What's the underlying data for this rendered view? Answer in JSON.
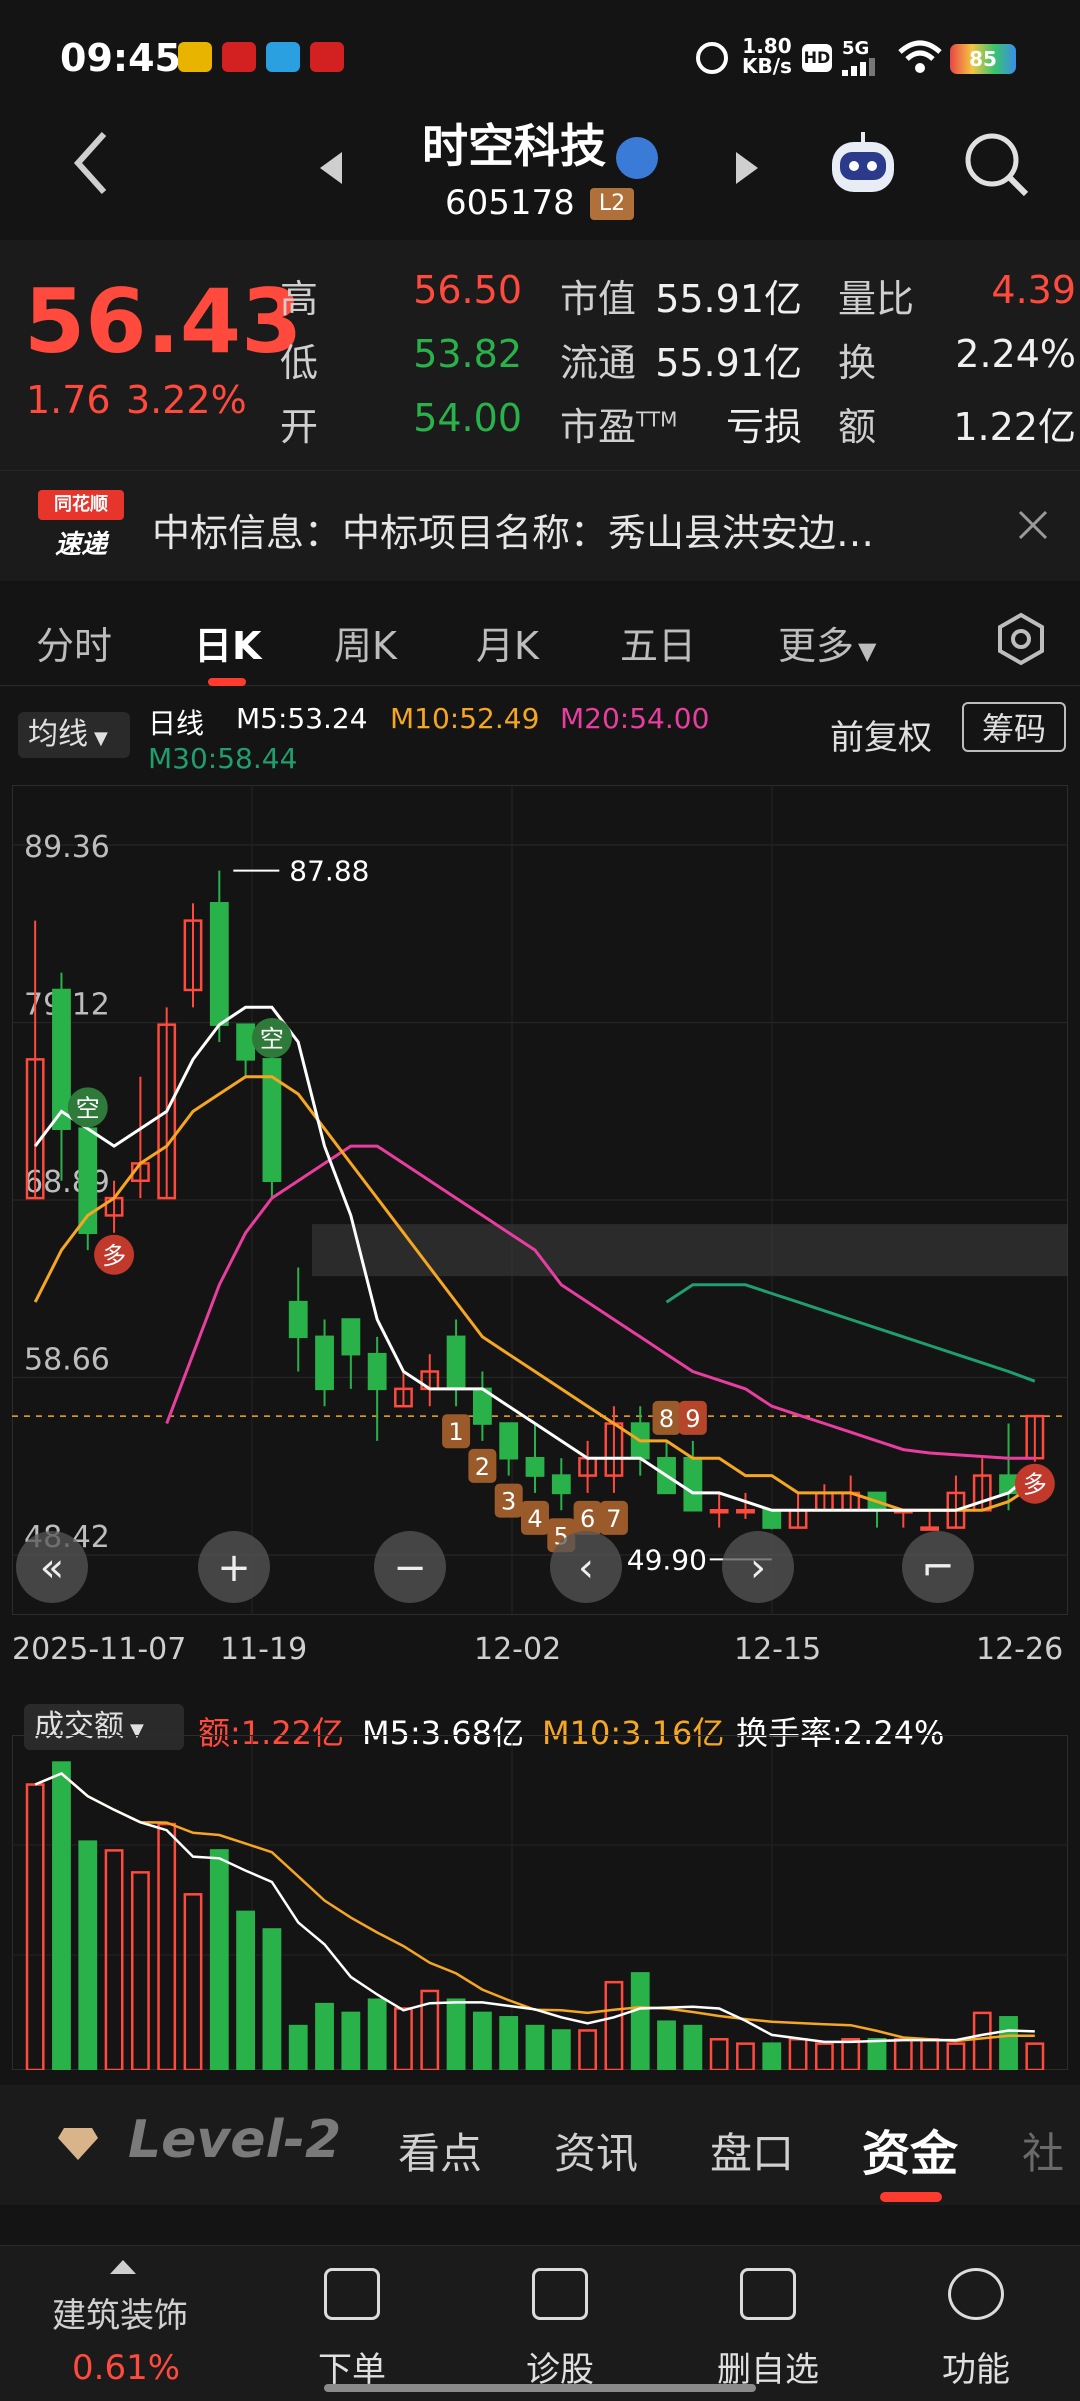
{
  "status_bar": {
    "time": "09:45",
    "net_speed": "1.80\nKB/s",
    "net_speed_top": "1.80",
    "net_speed_bottom": "KB/s",
    "signal": "5G",
    "battery": "85"
  },
  "header": {
    "name": "时空科技",
    "code": "605178",
    "level_badge": "L2"
  },
  "quote": {
    "price": "56.43",
    "change": "1.76",
    "change_pct": "3.22%",
    "high_label": "高",
    "high": "56.50",
    "low_label": "低",
    "low": "53.82",
    "open_label": "开",
    "open": "54.00",
    "mcap_label": "市值",
    "mcap": "55.91亿",
    "float_label": "流通",
    "float": "55.91亿",
    "pe_label": "市盈",
    "pe_sup": "TTM",
    "pe": "亏损",
    "volratio_label": "量比",
    "volratio": "4.39",
    "turnover_label": "换",
    "turnover": "2.24%",
    "amount_label": "额",
    "amount": "1.22亿"
  },
  "news": {
    "logo_top": "同花顺",
    "logo_bottom": "速递",
    "text": "中标信息：中标项目名称：秀山县洪安边…"
  },
  "tabs": [
    "分时",
    "日K",
    "周K",
    "月K",
    "五日",
    "更多"
  ],
  "active_tab": 1,
  "kline_header": {
    "indicator": "均线",
    "period": "日线",
    "m5": "M5:53.24",
    "m10": "M10:52.49",
    "m20": "M20:54.00",
    "m30": "M30:58.44",
    "adjust": "前复权",
    "chips": "筹码"
  },
  "colors": {
    "up": "#ff4a3d",
    "down": "#2ab24a",
    "m5": "#ffffff",
    "m10": "#f5a623",
    "m20": "#e83e9f",
    "m30": "#1f9e6e",
    "accent": "#ff3b30"
  },
  "chart_data": {
    "type": "candlestick",
    "y_ticks": [
      "89.36",
      "79.12",
      "68.89",
      "58.66",
      "48.42"
    ],
    "x_ticks": [
      "2025-11-07",
      "11-19",
      "12-02",
      "12-15",
      "12-26"
    ],
    "high_marker": "87.88",
    "low_marker": "49.90",
    "candles": [
      {
        "o": 69,
        "c": 77,
        "h": 85,
        "l": 69
      },
      {
        "o": 81,
        "c": 73,
        "h": 82,
        "l": 70
      },
      {
        "o": 73,
        "c": 67,
        "h": 74,
        "l": 66
      },
      {
        "o": 68,
        "c": 69,
        "h": 70,
        "l": 67
      },
      {
        "o": 70,
        "c": 71,
        "h": 76,
        "l": 69
      },
      {
        "o": 69,
        "c": 79,
        "h": 80,
        "l": 69
      },
      {
        "o": 81,
        "c": 85,
        "h": 86,
        "l": 80
      },
      {
        "o": 86,
        "c": 79,
        "h": 87.88,
        "l": 78
      },
      {
        "o": 79,
        "c": 77,
        "h": 79,
        "l": 76
      },
      {
        "o": 77,
        "c": 70,
        "h": 78,
        "l": 69
      },
      {
        "o": 63,
        "c": 61,
        "h": 65,
        "l": 59
      },
      {
        "o": 61,
        "c": 58,
        "h": 62,
        "l": 57
      },
      {
        "o": 62,
        "c": 60,
        "h": 62,
        "l": 58
      },
      {
        "o": 60,
        "c": 58,
        "h": 61,
        "l": 55
      },
      {
        "o": 57,
        "c": 58,
        "h": 59,
        "l": 57
      },
      {
        "o": 58,
        "c": 59,
        "h": 60,
        "l": 57
      },
      {
        "o": 61,
        "c": 58,
        "h": 62,
        "l": 57
      },
      {
        "o": 58,
        "c": 56,
        "h": 59,
        "l": 55
      },
      {
        "o": 56,
        "c": 54,
        "h": 56,
        "l": 53
      },
      {
        "o": 54,
        "c": 53,
        "h": 56,
        "l": 52
      },
      {
        "o": 53,
        "c": 52,
        "h": 54,
        "l": 51
      },
      {
        "o": 53,
        "c": 54,
        "h": 55,
        "l": 52
      },
      {
        "o": 53,
        "c": 56,
        "h": 57,
        "l": 52
      },
      {
        "o": 56,
        "c": 54,
        "h": 57,
        "l": 53
      },
      {
        "o": 54,
        "c": 52,
        "h": 55,
        "l": 52
      },
      {
        "o": 54,
        "c": 51,
        "h": 55,
        "l": 51
      },
      {
        "o": 51,
        "c": 51,
        "h": 52,
        "l": 50
      },
      {
        "o": 51,
        "c": 51,
        "h": 52,
        "l": 50.5
      },
      {
        "o": 51,
        "c": 50,
        "h": 51,
        "l": 49.9
      },
      {
        "o": 50,
        "c": 51,
        "h": 52,
        "l": 50
      },
      {
        "o": 51,
        "c": 52,
        "h": 52.5,
        "l": 51
      },
      {
        "o": 51,
        "c": 52,
        "h": 53,
        "l": 51
      },
      {
        "o": 52,
        "c": 51,
        "h": 52,
        "l": 50
      },
      {
        "o": 51,
        "c": 51,
        "h": 51,
        "l": 50
      },
      {
        "o": 50,
        "c": 50,
        "h": 51,
        "l": 50
      },
      {
        "o": 50,
        "c": 52,
        "h": 53,
        "l": 50
      },
      {
        "o": 51,
        "c": 53,
        "h": 54,
        "l": 51
      },
      {
        "o": 53,
        "c": 52,
        "h": 56,
        "l": 51
      },
      {
        "o": 54.0,
        "c": 56.43,
        "h": 56.5,
        "l": 53.8
      }
    ],
    "m5": [
      72,
      74,
      73,
      72,
      73,
      74,
      77,
      79,
      80,
      80,
      78,
      72,
      68,
      62,
      59,
      58,
      58,
      58,
      57,
      56,
      55,
      54,
      54,
      54,
      53,
      52,
      52,
      51.5,
      51,
      51,
      51,
      51,
      51,
      51,
      51,
      51,
      51.5,
      52,
      53.24
    ],
    "m10": [
      63,
      66,
      68,
      69,
      71,
      72,
      74,
      75,
      76,
      76,
      75,
      73,
      71,
      69,
      67,
      65,
      63,
      61,
      60,
      59,
      58,
      57,
      56,
      55,
      55,
      54,
      54,
      53,
      53,
      52,
      52,
      52,
      51.5,
      51,
      51,
      51,
      51,
      51.5,
      52.49
    ],
    "m20": [
      null,
      null,
      null,
      null,
      null,
      56,
      60,
      64,
      67,
      69,
      70,
      71,
      72,
      72,
      71,
      70,
      69,
      68,
      67,
      66,
      64,
      63,
      62,
      61,
      60,
      59,
      58.5,
      58,
      57,
      56.5,
      56,
      55.5,
      55,
      54.5,
      54.3,
      54.2,
      54.1,
      54,
      54.0
    ],
    "m30": [
      null,
      null,
      null,
      null,
      null,
      null,
      null,
      null,
      null,
      null,
      null,
      null,
      null,
      null,
      null,
      null,
      null,
      null,
      null,
      null,
      null,
      null,
      null,
      null,
      63,
      64,
      64,
      64,
      63.5,
      63,
      62.5,
      62,
      61.5,
      61,
      60.5,
      60,
      59.5,
      59,
      58.44
    ],
    "signals": [
      {
        "i": 2,
        "text": "空"
      },
      {
        "i": 3,
        "text": "多"
      },
      {
        "i": 9,
        "text": "空"
      },
      {
        "i": 38,
        "text": "多"
      }
    ],
    "counts": [
      {
        "i": 16,
        "text": "1"
      },
      {
        "i": 17,
        "text": "2"
      },
      {
        "i": 18,
        "text": "3"
      },
      {
        "i": 19,
        "text": "4"
      },
      {
        "i": 20,
        "text": "5"
      },
      {
        "i": 21,
        "text": "6"
      },
      {
        "i": 22,
        "text": "7"
      },
      {
        "i": 24,
        "text": "8"
      },
      {
        "i": 25,
        "text": "9"
      }
    ],
    "volume_header": {
      "indicator": "成交额",
      "amount": "额:1.22亿",
      "m5": "M5:3.68亿",
      "m10": "M10:3.16亿",
      "turnover": "换手率:2.24%"
    },
    "volume": [
      6.5,
      7.0,
      5.2,
      5.0,
      4.5,
      5.6,
      4.0,
      5.0,
      3.6,
      3.2,
      1.0,
      1.5,
      1.3,
      1.6,
      1.4,
      1.8,
      1.6,
      1.3,
      1.2,
      1.0,
      0.9,
      0.9,
      2.0,
      2.2,
      1.1,
      1.0,
      0.7,
      0.6,
      0.6,
      0.7,
      0.6,
      0.7,
      0.7,
      0.7,
      0.7,
      0.6,
      1.3,
      1.2,
      0.6
    ]
  },
  "l2bar": {
    "brand": "Level-2",
    "tabs": [
      "看点",
      "资讯",
      "盘口",
      "资金",
      "社"
    ],
    "active": 3
  },
  "bottom_nav": {
    "sector_name": "建筑装饰",
    "sector_pct": "0.61%",
    "items": [
      "下单",
      "诊股",
      "删自选",
      "功能"
    ]
  }
}
